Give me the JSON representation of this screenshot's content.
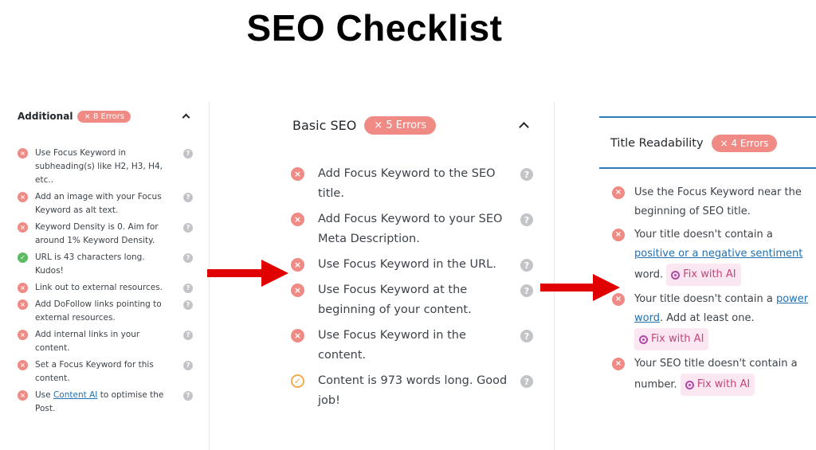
{
  "page_title": "SEO Checklist",
  "colors": {
    "error": "#ef8b84",
    "ok": "#5dbb63",
    "good": "#f0ad4e",
    "accent": "#2f7ab8",
    "arrow": "#e00000",
    "ai_chip": "#fbe7f1"
  },
  "additional": {
    "title": "Additional",
    "badge": "× 8 Errors",
    "items": [
      {
        "status": "error",
        "text": "Use Focus Keyword in subheading(s) like H2, H3, H4, etc.."
      },
      {
        "status": "error",
        "text": "Add an image with your Focus Keyword as alt text."
      },
      {
        "status": "error",
        "text": "Keyword Density is 0. Aim for around 1% Keyword Density."
      },
      {
        "status": "ok",
        "text": "URL is 43 characters long. Kudos!"
      },
      {
        "status": "error",
        "text": "Link out to external resources."
      },
      {
        "status": "error",
        "text": "Add DoFollow links pointing to external resources."
      },
      {
        "status": "error",
        "text": "Add internal links in your content."
      },
      {
        "status": "error",
        "text": "Set a Focus Keyword for this content."
      },
      {
        "status": "error",
        "pre": "Use ",
        "link": "Content AI",
        "post": " to optimise the Post."
      }
    ]
  },
  "basic_seo": {
    "title": "Basic SEO",
    "badge": "× 5 Errors",
    "items": [
      {
        "status": "error",
        "text": "Add Focus Keyword to the SEO title."
      },
      {
        "status": "error",
        "text": "Add Focus Keyword to your SEO Meta Description."
      },
      {
        "status": "error",
        "text": "Use Focus Keyword in the URL."
      },
      {
        "status": "error",
        "text": "Use Focus Keyword at the beginning of your content."
      },
      {
        "status": "error",
        "text": "Use Focus Keyword in the content."
      },
      {
        "status": "good",
        "text": "Content is 973 words long. Good job!"
      }
    ]
  },
  "title_readability": {
    "title": "Title Readability",
    "badge": "× 4 Errors",
    "fix_label": "Fix with AI",
    "items": [
      {
        "status": "error",
        "text": "Use the Focus Keyword near the beginning of SEO title."
      },
      {
        "status": "error",
        "pre": "Your title doesn't contain a ",
        "link": "positive or a negative sentiment",
        "post": " word."
      },
      {
        "status": "error",
        "pre": "Your title doesn't contain a ",
        "link": "power word",
        "post": ". Add at least one."
      },
      {
        "status": "error",
        "text": "Your SEO title doesn't contain a number."
      }
    ]
  }
}
